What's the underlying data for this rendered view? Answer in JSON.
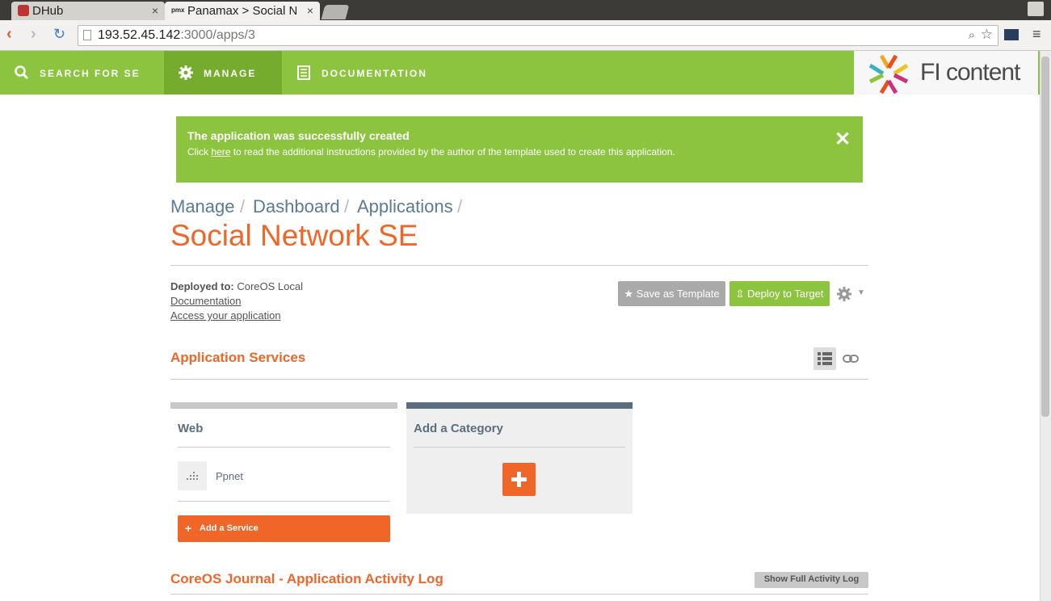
{
  "browser": {
    "tabs": [
      {
        "label": "DHub",
        "close": "×"
      },
      {
        "label": "Panamax > Social Ne",
        "prefix": "pmx",
        "close": "×"
      }
    ],
    "url_host": "193.52.45.142",
    "url_rest": ":3000/apps/3"
  },
  "nav": {
    "items": [
      {
        "label": "SEARCH FOR SE",
        "icon": "search-icon"
      },
      {
        "label": "MANAGE",
        "icon": "gear-icon"
      },
      {
        "label": "DOCUMENTATION",
        "icon": "document-icon"
      }
    ],
    "logo_text": "FI content",
    "active_color": "#76ac2d",
    "bar_color": "#8cc43f"
  },
  "alert": {
    "title": "The application was successfully created",
    "msg_prefix": "Click ",
    "msg_link": "here",
    "msg_suffix": " to read the additional instructions provided by the author of the template used to create this application.",
    "close": "✕"
  },
  "breadcrumb": {
    "items": [
      "Manage",
      "Dashboard",
      "Applications"
    ],
    "separator": "/"
  },
  "page_title": "Social Network SE",
  "deployment": {
    "label": "Deployed to:",
    "value": "CoreOS Local",
    "doc_link": "Documentation",
    "access_link": "Access your application"
  },
  "actions": {
    "save_template": "★ Save as Template",
    "deploy": "⇫ Deploy to Target"
  },
  "services": {
    "title": "Application Services",
    "categories": [
      {
        "name": "Web",
        "services": [
          {
            "name": "Ppnet"
          }
        ],
        "add_label": "Add a Service"
      }
    ],
    "add_category": "Add a Category"
  },
  "journal": {
    "title": "CoreOS Journal - Application Activity Log",
    "button": "Show Full Activity Log"
  },
  "colors": {
    "accent": "#ef6628",
    "green": "#8cc43f",
    "slate": "#5b7a94"
  }
}
